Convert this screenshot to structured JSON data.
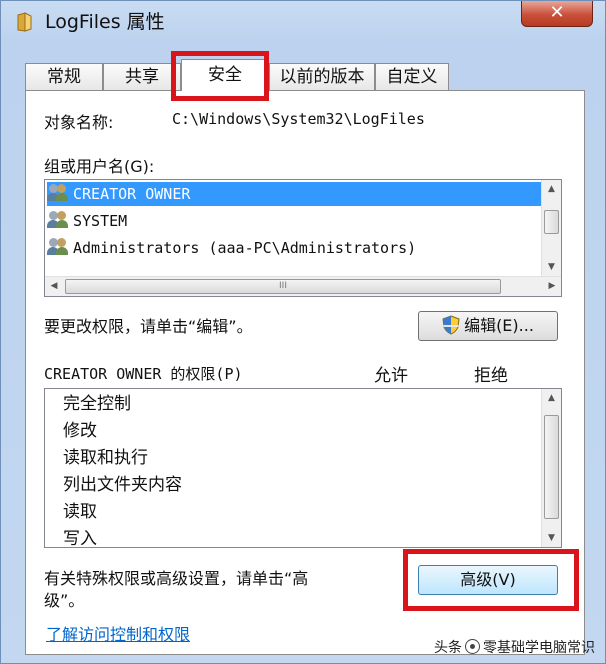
{
  "window": {
    "title": "LogFiles 属性",
    "close_glyph": "✕"
  },
  "tabs": [
    {
      "label": "常规"
    },
    {
      "label": "共享"
    },
    {
      "label": "安全",
      "active": true
    },
    {
      "label": "以前的版本"
    },
    {
      "label": "自定义"
    }
  ],
  "object_name": {
    "label": "对象名称:",
    "value": "C:\\Windows\\System32\\LogFiles"
  },
  "groups": {
    "label": "组或用户名(G):",
    "items": [
      {
        "name": "CREATOR OWNER",
        "selected": true
      },
      {
        "name": "SYSTEM",
        "selected": false
      },
      {
        "name": "Administrators (aaa-PC\\Administrators)",
        "selected": false
      }
    ],
    "scroll_thumb_glyph": "III"
  },
  "edit": {
    "hint": "要更改权限，请单击“编辑”。",
    "button_label": "编辑(E)..."
  },
  "permissions": {
    "header": "CREATOR OWNER 的权限(P)",
    "allow_header": "允许",
    "deny_header": "拒绝",
    "items": [
      "完全控制",
      "修改",
      "读取和执行",
      "列出文件夹内容",
      "读取",
      "写入"
    ]
  },
  "advanced": {
    "hint_line1": "有关特殊权限或高级设置，请单击“高",
    "hint_line2": "级”。",
    "button_label": "高级(V)"
  },
  "learn_link": "了解访问控制和权限",
  "watermark": {
    "prefix": "头条",
    "account": "零基础学电脑常识"
  },
  "colors": {
    "selection": "#3399ff",
    "highlight_box": "#d9141b",
    "link": "#0066cc"
  }
}
